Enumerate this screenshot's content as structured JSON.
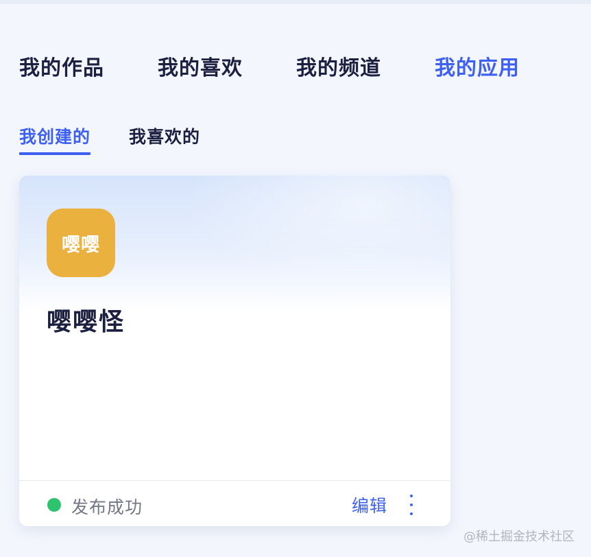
{
  "main_tabs": [
    {
      "label": "我的作品",
      "active": false
    },
    {
      "label": "我的喜欢",
      "active": false
    },
    {
      "label": "我的频道",
      "active": false
    },
    {
      "label": "我的应用",
      "active": true
    }
  ],
  "sub_tabs": [
    {
      "label": "我创建的",
      "active": true
    },
    {
      "label": "我喜欢的",
      "active": false
    }
  ],
  "app_card": {
    "icon_text": "嘤嘤",
    "icon_color": "#ebb13f",
    "name": "嘤嘤怪",
    "status": "发布成功",
    "status_color": "#2ec46e",
    "edit_label": "编辑",
    "more_icon": "more-vertical-icon"
  },
  "watermark": "@稀土掘金技术社区",
  "colors": {
    "accent": "#3e60f0",
    "text": "#1c1f3f",
    "muted": "#737685"
  }
}
